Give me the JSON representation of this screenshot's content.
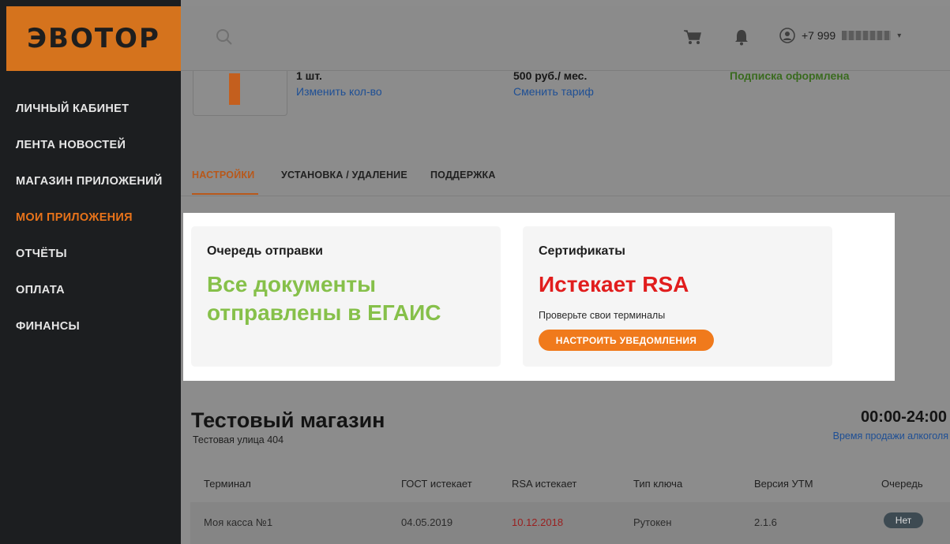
{
  "logo": {
    "text": "ЭВОТОР"
  },
  "sidebar": {
    "items": [
      {
        "label": "ЛИЧНЫЙ КАБИНЕТ",
        "active": false
      },
      {
        "label": "ЛЕНТА НОВОСТЕЙ",
        "active": false
      },
      {
        "label": "МАГАЗИН ПРИЛОЖЕНИЙ",
        "active": false
      },
      {
        "label": "МОИ ПРИЛОЖЕНИЯ",
        "active": true
      },
      {
        "label": "ОТЧЁТЫ",
        "active": false
      },
      {
        "label": "ОПЛАТА",
        "active": false
      },
      {
        "label": "ФИНАНСЫ",
        "active": false
      }
    ]
  },
  "header": {
    "search_icon": "search-icon",
    "cart_icon": "cart-icon",
    "bell_icon": "bell-icon",
    "account_icon": "user-circle-icon",
    "phone": "+7 999"
  },
  "app_info": {
    "quantity": "1 шт.",
    "change_quantity_link": "Изменить кол-во",
    "price": "500 руб./ мес.",
    "change_tariff_link": "Сменить тариф",
    "subscription_status": "Подписка оформлена"
  },
  "tabs": [
    {
      "label": "НАСТРОЙКИ",
      "active": true
    },
    {
      "label": "УСТАНОВКА / УДАЛЕНИЕ",
      "active": false
    },
    {
      "label": "ПОДДЕРЖКА",
      "active": false
    }
  ],
  "queue_card": {
    "title": "Очередь отправки",
    "status_line1": "Все документы",
    "status_line2": "отправлены в ЕГАИС",
    "status_color": "#86c04a"
  },
  "cert_card": {
    "title": "Сертификаты",
    "status": "Истекает RSA",
    "status_color": "#e11d1d",
    "hint": "Проверьте свои терминалы",
    "button_label": "НАСТРОИТЬ УВЕДОМЛЕНИЯ",
    "button_color": "#f07a1c"
  },
  "store": {
    "name": "Тестовый магазин",
    "address": "Тестовая улица 404",
    "hours": "00:00-24:00",
    "alcohol_link": "Время продажи алкоголя"
  },
  "table": {
    "columns": [
      "Терминал",
      "ГОСТ истекает",
      "RSA истекает",
      "Тип ключа",
      "Версия УТМ",
      "Очередь"
    ],
    "rows": [
      {
        "terminal": "Моя касса №1",
        "gost": "04.05.2019",
        "rsa": "10.12.2018",
        "key_type": "Рутокен",
        "utm": "2.1.6",
        "queue": "Нет"
      }
    ]
  },
  "colors": {
    "accent": "#e8731a",
    "brand_orange": "#d5731d"
  }
}
